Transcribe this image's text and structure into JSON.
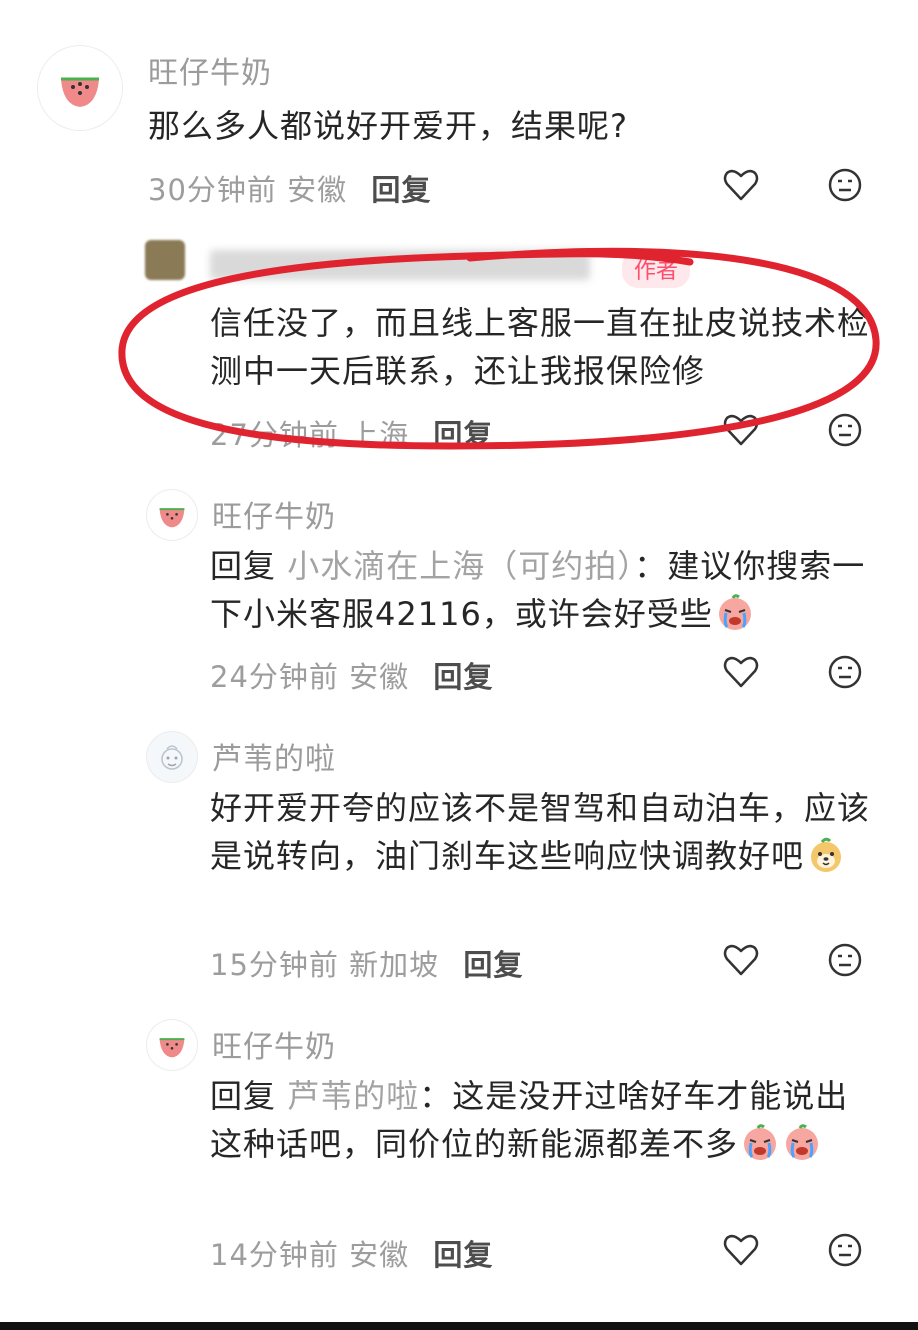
{
  "comments": [
    {
      "username": "旺仔牛奶",
      "content": "那么多人都说好开爱开，结果呢?",
      "time": "30分钟前",
      "location": "安徽",
      "reply_label": "回复"
    },
    {
      "username": "",
      "author_tag": "作者",
      "content": "信任没了，而且线上客服一直在扯皮说技术检测中一天后联系，还让我报保险修",
      "time": "27分钟前",
      "location": "上海",
      "reply_label": "回复"
    },
    {
      "username": "旺仔牛奶",
      "reply_prefix": "回复",
      "reply_target": "小水滴在上海（可约拍）",
      "content": "：建议你搜索一下小米客服42116，或许会好受些",
      "time": "24分钟前",
      "location": "安徽",
      "reply_label": "回复"
    },
    {
      "username": "芦苇的啦",
      "content": "好开爱开夸的应该不是智驾和自动泊车，应该是说转向，油门刹车这些响应快调教好吧",
      "time": "15分钟前",
      "location": "新加坡",
      "reply_label": "回复"
    },
    {
      "username": "旺仔牛奶",
      "reply_prefix": "回复",
      "reply_target": "芦苇的啦",
      "content": "：这是没开过啥好车才能说出这种话吧，同价位的新能源都差不多",
      "time": "14分钟前",
      "location": "安徽",
      "reply_label": "回复"
    }
  ],
  "icons": {
    "like": "heart-outline-icon",
    "dislike": "neutral-face-icon",
    "avatar_watermelon": "watermelon-icon",
    "emoji_crying": "crying-face-emoji",
    "emoji_puppy": "puppy-emoji"
  },
  "colors": {
    "annotation_circle": "#e0242f",
    "author_tag": "#ff4d6d",
    "secondary_text": "#9d9d9d"
  }
}
